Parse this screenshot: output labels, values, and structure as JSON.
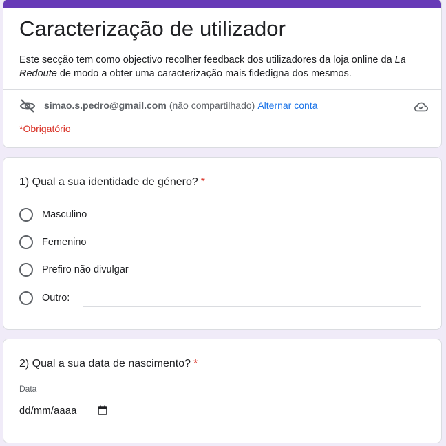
{
  "form": {
    "title": "Caracterização de utilizador",
    "description_before": "Este secção tem como objectivo recolher feedback dos utilizadores da loja online da ",
    "description_brand": "La Redoute",
    "description_after": " de modo a obter uma caracterização mais fidedigna dos mesmos.",
    "accent_color": "#673ab7",
    "background_color": "#f0ebf8"
  },
  "account": {
    "email": "simao.s.pedro@gmail.com",
    "shared_status": "(não compartilhado)",
    "switch_label": "Alternar conta",
    "hide_icon": "eye-off-icon",
    "save_icon": "cloud-check-icon"
  },
  "required_note": "*Obrigatório",
  "questions": [
    {
      "title": "1) Qual a sua identidade de género?",
      "required_mark": "*",
      "options": [
        "Masculino",
        "Femenino",
        "Prefiro não divulgar"
      ],
      "other_label": "Outro:"
    },
    {
      "title": "2) Qual a sua data de nascimento?",
      "required_mark": "*",
      "date_caption": "Data",
      "date_placeholder": "dd/mm/aaaa",
      "date_icon": "calendar-icon"
    }
  ]
}
